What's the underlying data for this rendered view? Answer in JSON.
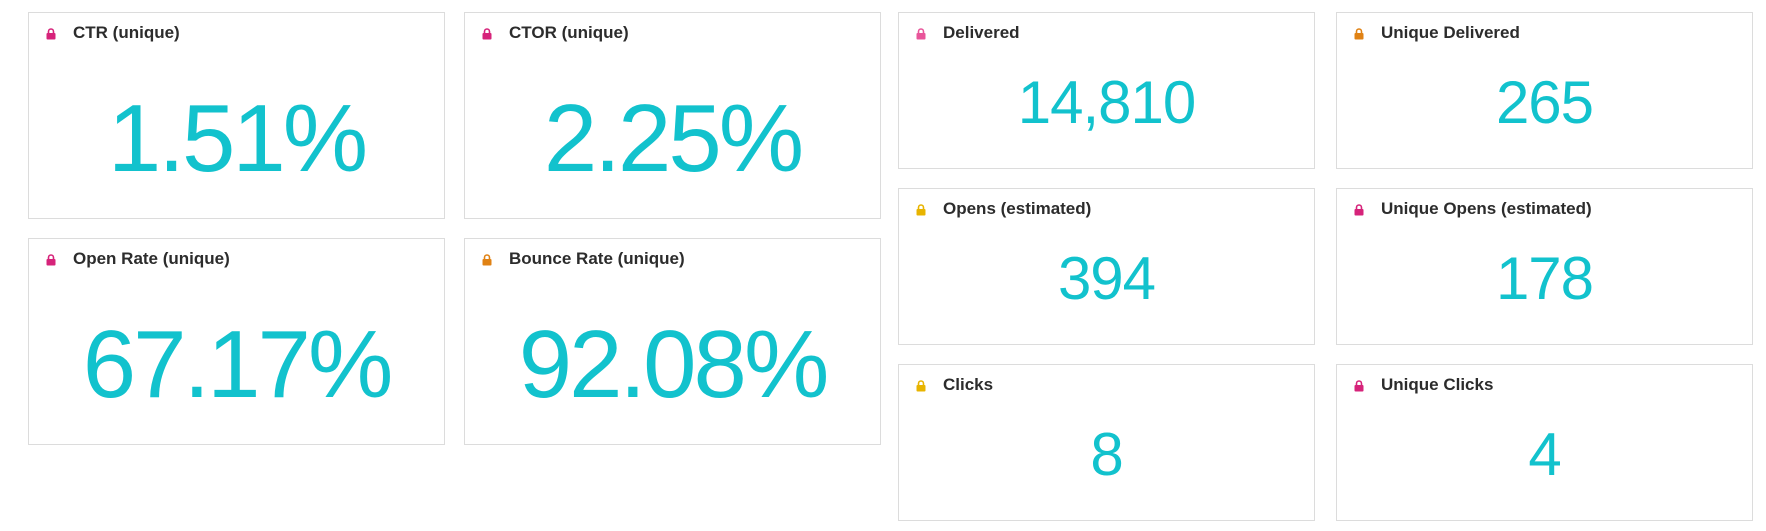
{
  "colors": {
    "value": "#12c2cd",
    "title": "#2c2c2c",
    "border": "#dcdcdc",
    "lock_magenta": "#d6237a",
    "lock_orange": "#e08214",
    "lock_yellow": "#e8b400"
  },
  "cards": {
    "ctr": {
      "title": "CTR (unique)",
      "value": "1.51%",
      "icon": "lock-icon"
    },
    "ctor": {
      "title": "CTOR (unique)",
      "value": "2.25%",
      "icon": "lock-icon"
    },
    "open_rate": {
      "title": "Open Rate (unique)",
      "value": "67.17%",
      "icon": "lock-icon"
    },
    "bounce_rate": {
      "title": "Bounce Rate (unique)",
      "value": "92.08%",
      "icon": "lock-icon"
    },
    "delivered": {
      "title": "Delivered",
      "value": "14,810",
      "icon": "lock-icon"
    },
    "unique_delivered": {
      "title": "Unique Delivered",
      "value": "265",
      "icon": "lock-icon"
    },
    "opens": {
      "title": "Opens (estimated)",
      "value": "394",
      "icon": "lock-icon"
    },
    "unique_opens": {
      "title": "Unique Opens (estimated)",
      "value": "178",
      "icon": "lock-icon"
    },
    "clicks": {
      "title": "Clicks",
      "value": "8",
      "icon": "lock-icon"
    },
    "unique_clicks": {
      "title": "Unique Clicks",
      "value": "4",
      "icon": "lock-icon"
    }
  }
}
